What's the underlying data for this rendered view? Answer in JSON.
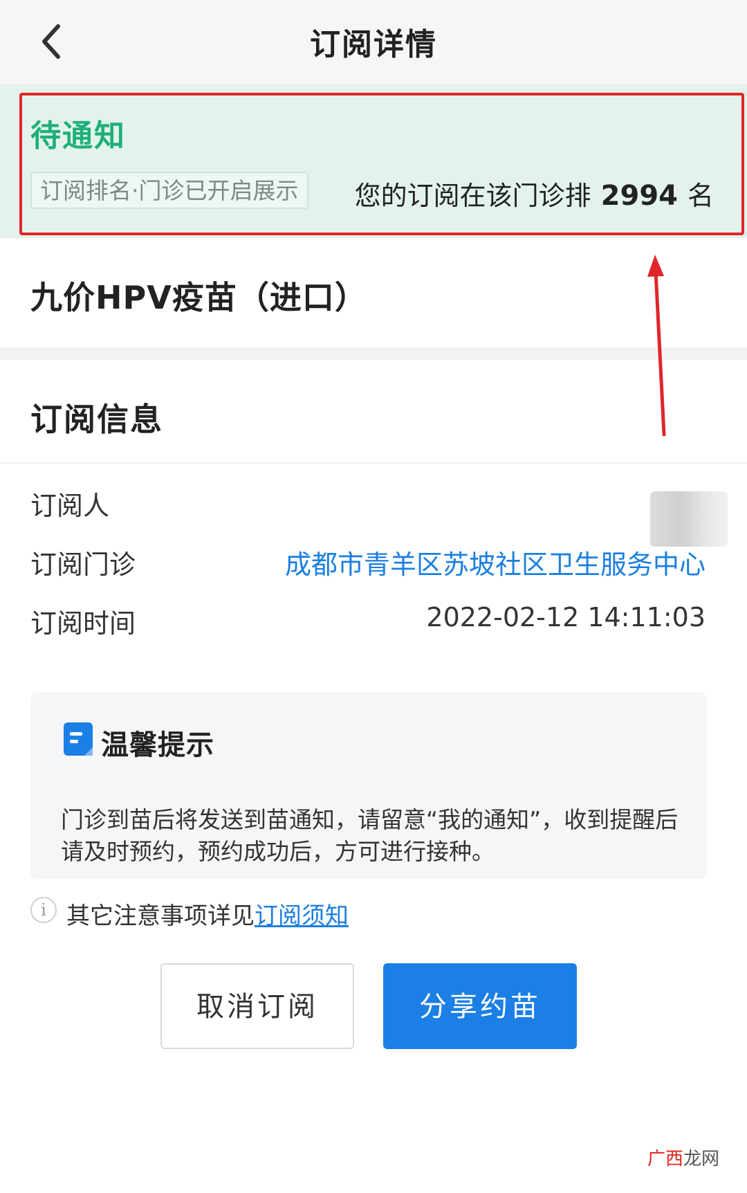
{
  "header": {
    "title": "订阅详情",
    "back_icon": "chevron-left-icon"
  },
  "status": {
    "title": "待通知",
    "tag": "订阅排名·门诊已开启展示",
    "rank_prefix": "您的订阅在该门诊排",
    "rank_number": "2994",
    "rank_suffix": "名",
    "title_color": "#1faf7a",
    "banner_color": "#e3f3ec",
    "highlight_color": "#e0262b"
  },
  "vaccine": {
    "name": "九价HPV疫苗（进口）"
  },
  "subscription_info": {
    "title": "订阅信息",
    "rows": [
      {
        "label": "订阅人",
        "value": ""
      },
      {
        "label": "订阅门诊",
        "value": "成都市青羊区苏坡社区卫生服务中心"
      },
      {
        "label": "订阅时间",
        "value": "2022-02-12 14:11:03"
      }
    ]
  },
  "tips": {
    "icon": "note-icon",
    "title": "温馨提示",
    "body": "门诊到苗后将发送到苗通知，请留意“我的通知”，收到提醒后请及时预约，预约成功后，方可进行接种。"
  },
  "notice": {
    "icon": "info-icon",
    "text": "其它注意事项详见",
    "link": "订阅须知"
  },
  "actions": {
    "cancel_label": "取消订阅",
    "share_label": "分享约苗",
    "share_color": "#1b7fe6"
  },
  "watermark": {
    "accent": "广西",
    "rest": "龙网"
  }
}
